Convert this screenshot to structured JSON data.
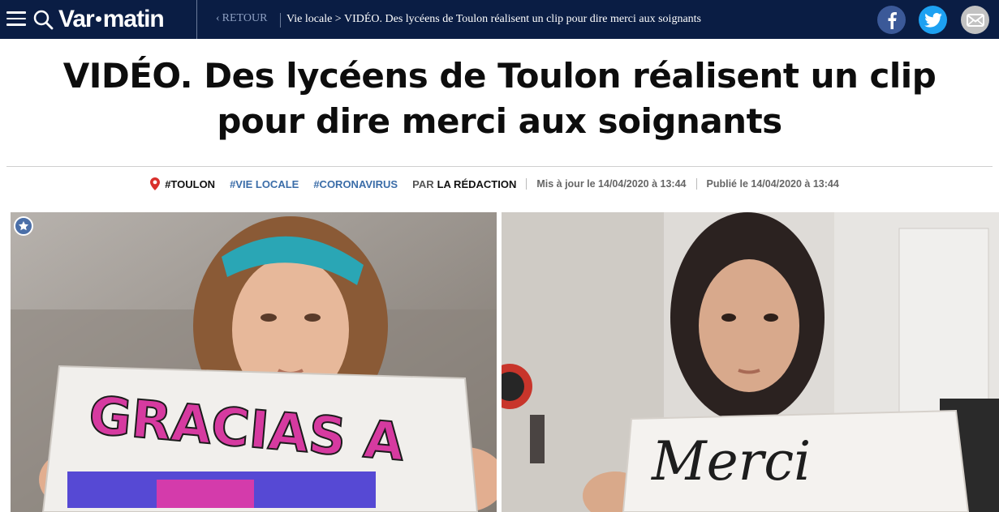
{
  "header": {
    "logo_left": "Var",
    "logo_right": "matin",
    "back_label": "RETOUR",
    "breadcrumb_section": "Vie locale",
    "breadcrumb_sep": " > ",
    "breadcrumb_current": "VIDÉO. Des lycéens de Toulon réalisent un clip pour dire merci aux soignants",
    "share": [
      {
        "icon": "facebook-icon",
        "color": "#3b5998"
      },
      {
        "icon": "twitter-icon",
        "color": "#1da1f2"
      },
      {
        "icon": "mail-icon",
        "color": "#c2c2c2"
      }
    ],
    "bar_color": "#0a1d44"
  },
  "article": {
    "title": "VIDÉO. Des lycéens de Toulon réalisent un clip pour dire merci aux soignants",
    "tags": [
      "#TOULON",
      "#VIE LOCALE",
      "#CORONAVIRUS"
    ],
    "by_prefix": "PAR",
    "author": "LA RÉDACTION",
    "updated": "Mis à jour le 14/04/2020 à 13:44",
    "published": "Publié le 14/04/2020 à 13:44",
    "tag_color": "#3b6da8",
    "pin_color": "#d9302c"
  },
  "images": {
    "left_sign_text": "GRACIAS A",
    "right_sign_text": "Merci"
  }
}
